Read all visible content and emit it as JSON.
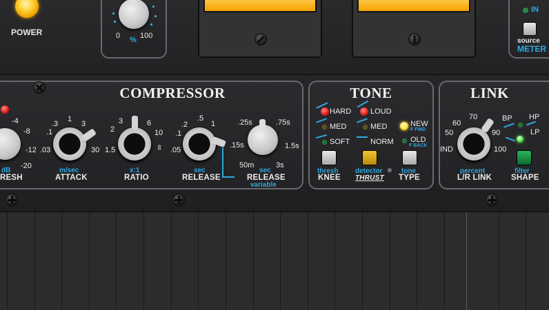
{
  "power": {
    "label": "POWER"
  },
  "mix_knob": {
    "min": "0",
    "max": "100",
    "unit": "%"
  },
  "source_meter": {
    "in_label": "IN",
    "source_label": "source",
    "meter_label": "METER"
  },
  "compressor": {
    "title": "COMPRESSOR",
    "threshold": {
      "ticks": [
        "-4",
        "-8",
        "-12",
        "-20"
      ],
      "unit": "dB",
      "name": "RESH"
    },
    "attack": {
      "ticks": [
        ".1",
        ".3",
        "1",
        "3",
        ".03",
        "30"
      ],
      "unit": "m/sec",
      "name": "ATTACK"
    },
    "ratio": {
      "ticks": [
        "2",
        "3",
        "6",
        "10",
        "1.5",
        "∞"
      ],
      "unit": "x:1",
      "name": "RATIO"
    },
    "release": {
      "ticks": [
        ".2",
        ".5",
        "1",
        ".1",
        ".05"
      ],
      "unit": "sec",
      "name": "RELEASE"
    },
    "release_variable": {
      "ticks": [
        ".25s",
        ".75s",
        ".15s",
        "1.5s",
        "50m",
        "3s"
      ],
      "unit": "sec",
      "name": "RELEASE",
      "sub": "variable"
    }
  },
  "tone": {
    "title": "TONE",
    "knee": {
      "options": [
        "HARD",
        "MED",
        "SOFT"
      ],
      "unit": "thresh",
      "name": "KNEE"
    },
    "detector": {
      "options": [
        "LOUD",
        "MED",
        "NORM"
      ],
      "unit": "detector",
      "name": "THRUST",
      "mark": "®"
    },
    "type": {
      "options": [
        "NEW",
        "OLD"
      ],
      "sub_new": "F FWD",
      "sub_old": "F BACK",
      "unit": "tone",
      "name": "TYPE"
    }
  },
  "link": {
    "title": "LINK",
    "lr_link": {
      "ticks": [
        "60",
        "70",
        "50",
        "90",
        "IND",
        "100"
      ],
      "unit": "percent",
      "name": "L/R LINK"
    },
    "shape": {
      "options": [
        "BP",
        "HP",
        "LP"
      ],
      "unit": "filter",
      "name": "SHAPE"
    }
  },
  "colors": {
    "accent": "#2fa8e0",
    "led_red": "#e41a1a",
    "led_yellow": "#ffe23a",
    "led_green": "#58e24a"
  }
}
